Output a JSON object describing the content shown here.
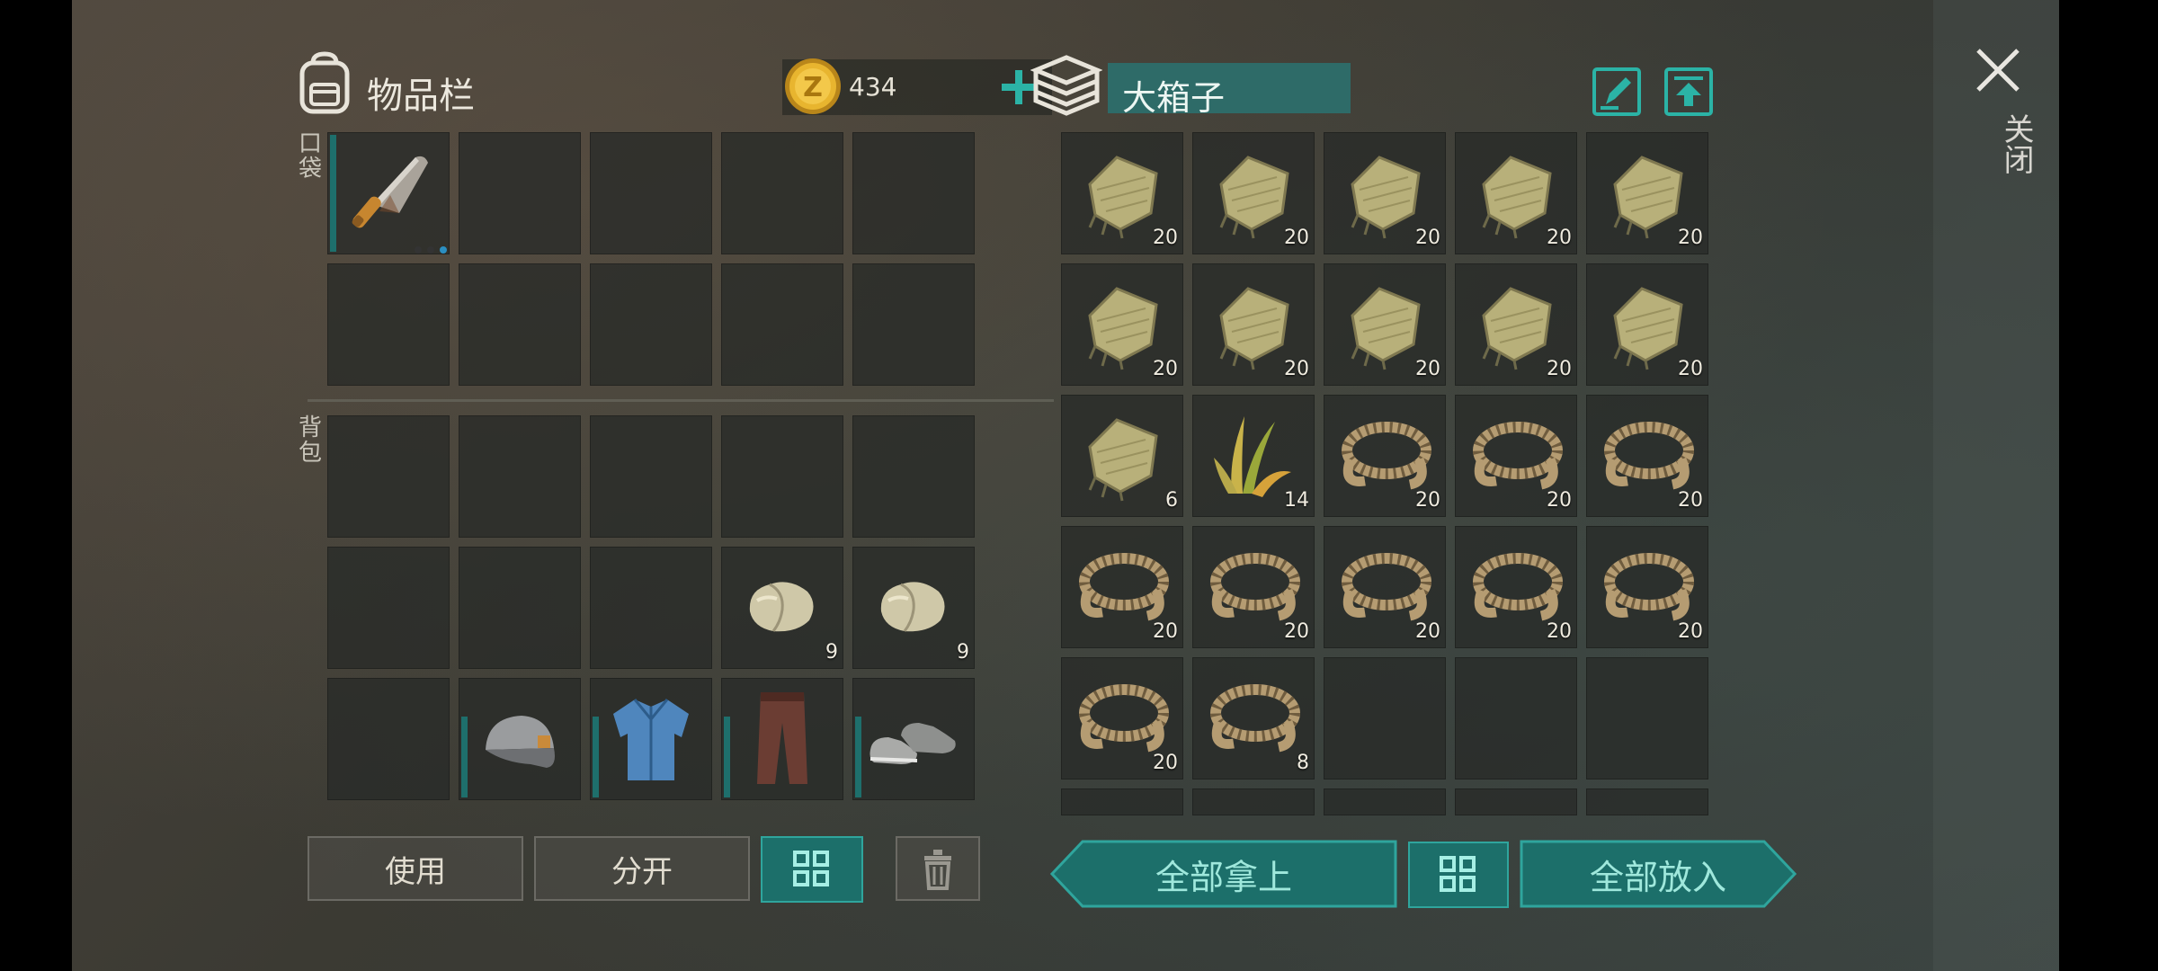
{
  "inventory": {
    "title": "物品栏",
    "pocket_label": "口袋",
    "backpack_label": "背包",
    "coin_count": "434",
    "coin_symbol": "Z",
    "pocket_items": [
      {
        "name": "cleaver",
        "count": ""
      }
    ],
    "backpack_items": [
      {
        "name": "stone",
        "count": "9"
      },
      {
        "name": "stone",
        "count": "9"
      }
    ],
    "equipment": [
      "cap",
      "shirt",
      "pants",
      "shoes"
    ],
    "buttons": {
      "use": "使用",
      "split": "分开"
    }
  },
  "container": {
    "title": "大箱子",
    "items": [
      {
        "name": "cloth",
        "count": "20"
      },
      {
        "name": "cloth",
        "count": "20"
      },
      {
        "name": "cloth",
        "count": "20"
      },
      {
        "name": "cloth",
        "count": "20"
      },
      {
        "name": "cloth",
        "count": "20"
      },
      {
        "name": "cloth",
        "count": "20"
      },
      {
        "name": "cloth",
        "count": "20"
      },
      {
        "name": "cloth",
        "count": "20"
      },
      {
        "name": "cloth",
        "count": "20"
      },
      {
        "name": "cloth",
        "count": "20"
      },
      {
        "name": "cloth",
        "count": "6"
      },
      {
        "name": "plant-fiber",
        "count": "14"
      },
      {
        "name": "rope",
        "count": "20"
      },
      {
        "name": "rope",
        "count": "20"
      },
      {
        "name": "rope",
        "count": "20"
      },
      {
        "name": "rope",
        "count": "20"
      },
      {
        "name": "rope",
        "count": "20"
      },
      {
        "name": "rope",
        "count": "20"
      },
      {
        "name": "rope",
        "count": "20"
      },
      {
        "name": "rope",
        "count": "20"
      },
      {
        "name": "rope",
        "count": "20"
      },
      {
        "name": "rope",
        "count": "8"
      }
    ],
    "buttons": {
      "take_all": "全部拿上",
      "put_all": "全部放入"
    }
  },
  "close": {
    "label": "关闭"
  },
  "colors": {
    "teal": "#1c6f6a",
    "teal_text": "#9fe8dc",
    "bar": "#1e6f6c"
  }
}
